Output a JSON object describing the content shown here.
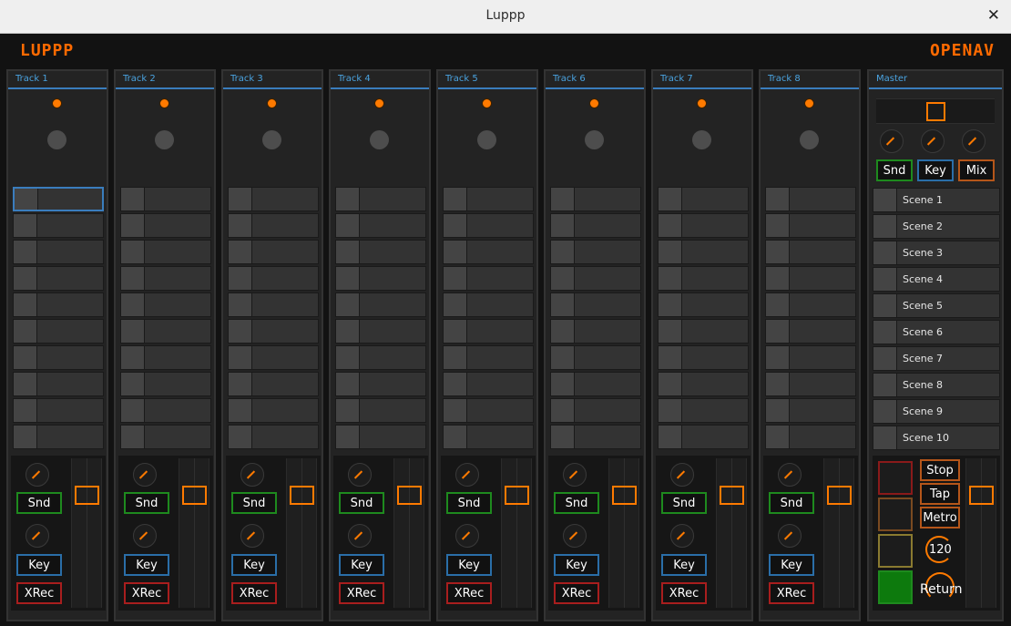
{
  "window": {
    "title": "Luppp",
    "close_icon": "close-icon"
  },
  "logos": {
    "left": "LUPPP",
    "right": "OPENAV"
  },
  "colors": {
    "accent": "#ff7a00",
    "blue": "#3a7dbd",
    "green": "#1e8a1e",
    "red": "#a81e1e"
  },
  "tracks": [
    {
      "name": "Track 1",
      "snd": "Snd",
      "key": "Key",
      "xrec": "XRec"
    },
    {
      "name": "Track 2",
      "snd": "Snd",
      "key": "Key",
      "xrec": "XRec"
    },
    {
      "name": "Track 3",
      "snd": "Snd",
      "key": "Key",
      "xrec": "XRec"
    },
    {
      "name": "Track 4",
      "snd": "Snd",
      "key": "Key",
      "xrec": "XRec"
    },
    {
      "name": "Track 5",
      "snd": "Snd",
      "key": "Key",
      "xrec": "XRec"
    },
    {
      "name": "Track 6",
      "snd": "Snd",
      "key": "Key",
      "xrec": "XRec"
    },
    {
      "name": "Track 7",
      "snd": "Snd",
      "key": "Key",
      "xrec": "XRec"
    },
    {
      "name": "Track 8",
      "snd": "Snd",
      "key": "Key",
      "xrec": "XRec"
    }
  ],
  "master": {
    "name": "Master",
    "buttons": {
      "snd": "Snd",
      "key": "Key",
      "mix": "Mix"
    },
    "scenes": [
      "Scene 1",
      "Scene 2",
      "Scene 3",
      "Scene 4",
      "Scene 5",
      "Scene 6",
      "Scene 7",
      "Scene 8",
      "Scene 9",
      "Scene 10"
    ],
    "transport": {
      "stop": "Stop",
      "tap": "Tap",
      "metro": "Metro"
    },
    "bpm": "120",
    "return_label": "Return"
  }
}
